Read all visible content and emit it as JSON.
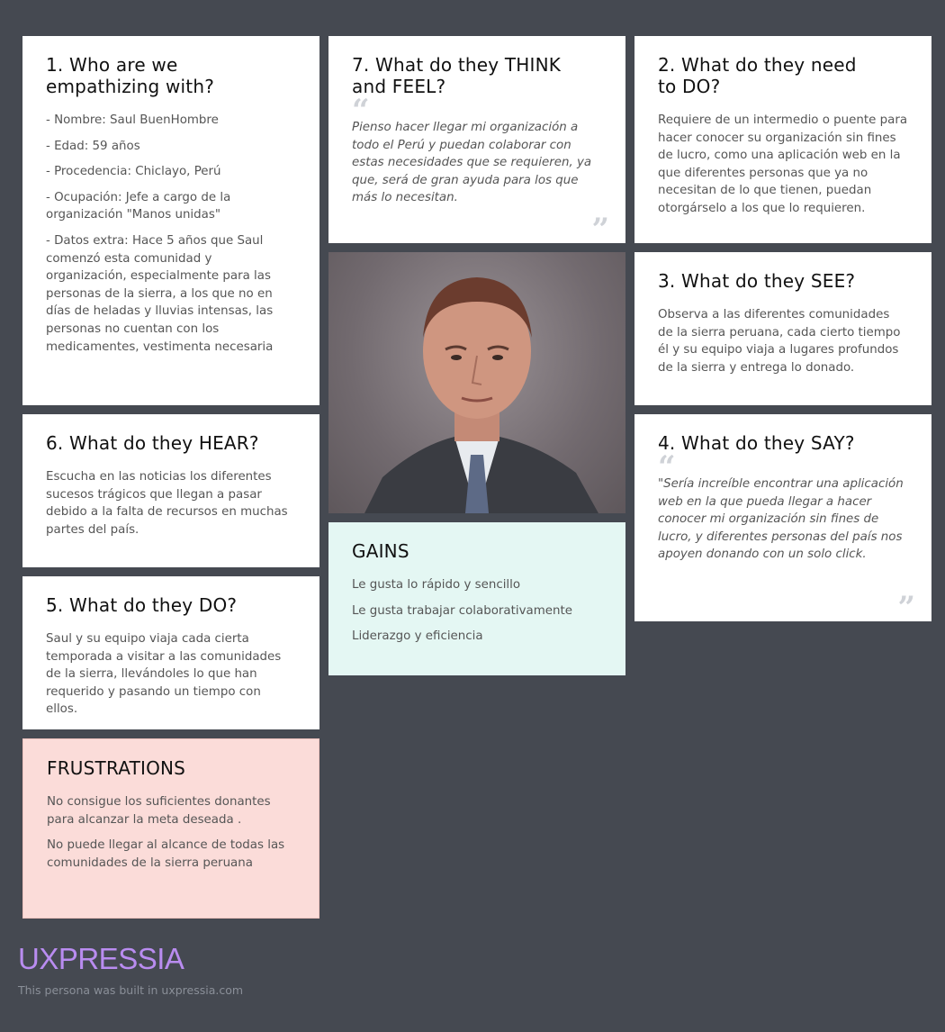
{
  "who": {
    "title": "1. Who are we empathizing with?",
    "items": [
      "- Nombre: Saul BuenHombre",
      "- Edad: 59 años",
      "- Procedencia: Chiclayo, Perú",
      "- Ocupación: Jefe a cargo de la organización \"Manos unidas\"",
      "- Datos extra: Hace 5 años que Saul comenzó esta comunidad y organización, especialmente para las personas de la sierra, a los que no en días de heladas y lluvias intensas, las personas no cuentan con los medicamentes, vestimenta necesaria"
    ]
  },
  "think_feel": {
    "title": "7. What do they THINK and FEEL?",
    "text": "Pienso hacer llegar mi organización a todo el Perú y puedan colaborar con estas necesidades que se requieren, ya que, será de gran ayuda para los que más lo necesitan."
  },
  "need_do": {
    "title": "2. What do they need to DO?",
    "text": "Requiere de un intermedio o puente para hacer conocer su organización sin fines de lucro, como una aplicación web en la que diferentes personas que ya no necesitan de lo que tienen, puedan otorgárselo a los que lo requieren."
  },
  "see": {
    "title": "3. What do they SEE?",
    "text": "Observa a las diferentes comunidades de la sierra peruana, cada cierto tiempo él y su equipo viaja a lugares profundos de la sierra y entrega lo donado."
  },
  "hear": {
    "title": "6. What do they HEAR?",
    "text": "Escucha en las noticias los diferentes sucesos trágicos que llegan a pasar debido a la falta de recursos en muchas partes del país."
  },
  "say": {
    "title": "4. What do they SAY?",
    "text": "\"Sería increíble encontrar una aplicación web en la que pueda llegar a hacer conocer mi organización sin fines de lucro, y diferentes personas del país nos apoyen donando con un solo click."
  },
  "do": {
    "title": "5. What do they DO?",
    "text": "Saul y su equipo viaja cada cierta temporada a visitar a las comunidades de la sierra, llevándoles lo que han requerido y pasando un tiempo con ellos."
  },
  "gains": {
    "title": "GAINS",
    "items": [
      "Le gusta lo rápido y sencillo",
      "Le gusta trabajar colaborativamente",
      "Liderazgo y eficiencia"
    ]
  },
  "frustrations": {
    "title": "FRUSTRATIONS",
    "items": [
      "No consigue los suficientes donantes para alcanzar la meta deseada .",
      "No puede llegar al alcance de todas las comunidades de la sierra peruana"
    ]
  },
  "quote_open": "“",
  "quote_close": "”",
  "brand": {
    "logo": "UXPRESSIA",
    "footer": "This persona was built in uxpressia.com"
  },
  "colors": {
    "background": "#454951",
    "card": "#ffffff",
    "gains_bg": "#e4f7f3",
    "frustrations_bg": "#fbdcd9",
    "logo": "#b98cf0"
  }
}
